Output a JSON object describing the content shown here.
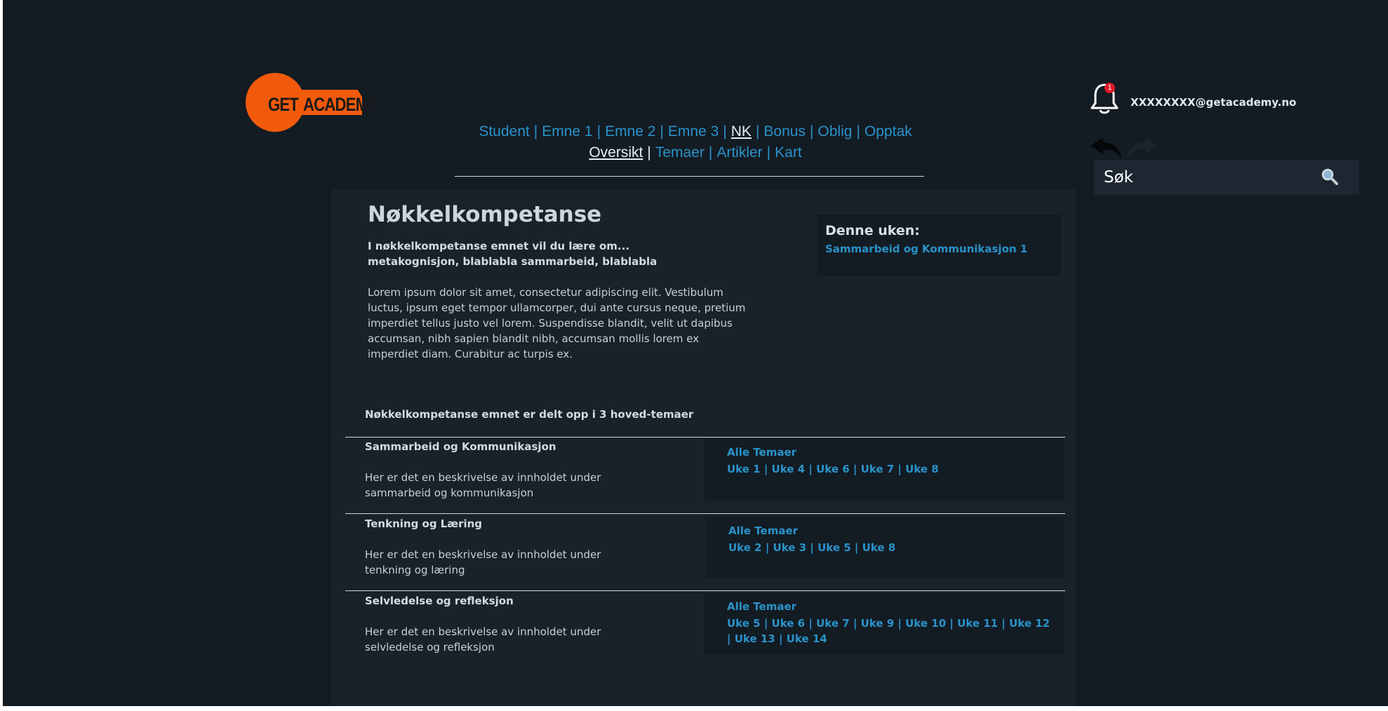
{
  "logo": {
    "word1": "GET",
    "word2": "ACADEMY"
  },
  "nav": {
    "primary": [
      "Student",
      "Emne 1",
      "Emne 2",
      "Emne 3",
      "NK",
      "Bonus",
      "Oblig",
      "Opptak"
    ],
    "secondary": [
      "Oversikt",
      "Temaer",
      "Artikler",
      "Kart"
    ]
  },
  "header": {
    "notification_count": "1",
    "email": "XXXXXXXX@getacademy.no",
    "search_placeholder": "Søk"
  },
  "page": {
    "title": "Nøkkelkompetanse",
    "intro_line1": "I nøkkelkompetanse emnet vil du lære om...",
    "intro_line2": "metakognisjon, blablabla sammarbeid, blablabla",
    "lorem": "Lorem ipsum dolor sit amet, consectetur adipiscing elit. Vestibulum luctus, ipsum eget tempor ullamcorper, dui ante cursus neque, pretium imperdiet tellus justo vel lorem. Suspendisse blandit, velit ut dapibus accumsan, nibh sapien blandit nibh, accumsan mollis lorem ex imperdiet diam. Curabitur ac turpis ex.",
    "week_box": {
      "title": "Denne uken:",
      "link": "Sammarbeid og Kommunikasjon 1"
    },
    "themes_heading": "Nøkkelkompetanse emnet er delt opp i 3 hoved-temaer"
  },
  "themes": [
    {
      "title": "Sammarbeid og Kommunikasjon",
      "desc": "Her er det en beskrivelse av innholdet under sammarbeid og kommunikasjon",
      "all_label": "Alle Temaer",
      "weeks": [
        "Uke 1",
        "Uke 4",
        "Uke 6",
        "Uke 7",
        "Uke 8"
      ]
    },
    {
      "title": "Tenkning og Læring",
      "desc": "Her er det en beskrivelse av innholdet under tenkning og læring",
      "all_label": "Alle Temaer",
      "weeks": [
        "Uke 2",
        "Uke 3",
        "Uke 5",
        "Uke 8"
      ]
    },
    {
      "title": "Selvledelse og refleksjon",
      "desc": "Her er det en beskrivelse av innholdet under selvledelse og refleksjon",
      "all_label": "Alle Temaer",
      "weeks": [
        "Uke 5",
        "Uke 6",
        "Uke 7",
        "Uke 9",
        "Uke 10",
        "Uke 11",
        "Uke 12",
        "Uke 13",
        "Uke 14"
      ]
    }
  ],
  "colors": {
    "background": "#131b23",
    "panel": "#18222b",
    "accent": "#2a93c9",
    "brand": "#f15a0a"
  }
}
